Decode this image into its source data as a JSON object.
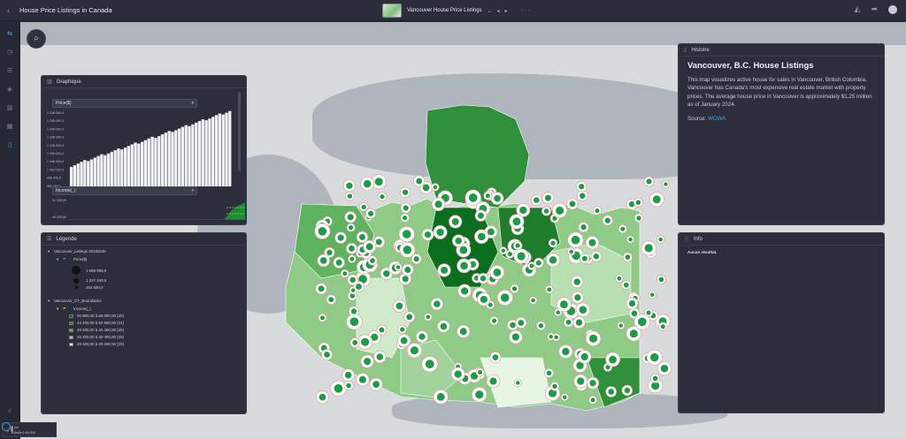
{
  "app": {
    "title": "House Price Listings in Canada",
    "back_icon": "chevron-left-icon",
    "map_title": "Vancouver House Price Listings",
    "more": "· · ·",
    "right_icons": [
      "ruler-icon",
      "share-icon",
      "user-avatar"
    ]
  },
  "left_rail": [
    "layers-icon",
    "clock-icon",
    "list-icon",
    "stack-icon",
    "chart-icon",
    "table-icon",
    "book-icon"
  ],
  "graph_panel": {
    "title": "Graphique",
    "field_1": "Price($)",
    "y_ticks": [
      "1 346 000,0",
      "1 295 000,0",
      "1 246 000,0",
      "1 196 000,0",
      "1 146 000,0",
      "1 096 000,0",
      "1 046 000,0",
      "1 000 000,0",
      "946 000,0",
      "900 000,0"
    ],
    "field_2": "Income(_)",
    "hist_top": "51 205,00",
    "hist_bottom": "45 205,00"
  },
  "legend_panel": {
    "title": "Légende",
    "layer1": {
      "name": "Vancouver_Listings 20240220",
      "field": "Price($)",
      "values": [
        "1 999 999,0",
        "1 227 249,5",
        "454 500,0"
      ]
    },
    "layer2": {
      "name": "Vancouver_CT_Boundaries",
      "field": "Income(_)",
      "classes": [
        {
          "label": "50 900,00 à 68 000,00 (25)",
          "color": "#0b6e1e"
        },
        {
          "label": "44 400,00 à 50 900,00 (24)",
          "color": "#2f8f3a"
        },
        {
          "label": "40 400,00 à 44 400,00 (25)",
          "color": "#5fb35f"
        },
        {
          "label": "35 200,00 à 40 400,00 (25)",
          "color": "#a3d39c"
        },
        {
          "label": "28 200,00 à 35 200,00 (26)",
          "color": "#e8f5e4"
        }
      ]
    }
  },
  "histoire_panel": {
    "title": "Histoire",
    "heading": "Vancouver, B.C. House Listings",
    "body": "This map visualizes active house for sales in Vancouver, British Columbia. Vancouver has Canada's most expensive real estate market with property prices. The average house price in Vancouver is approximately $1.25 million as of January 2024.",
    "source_label": "Source:",
    "source_link": "WOWA"
  },
  "info_panel": {
    "title": "Info",
    "text": "Aucun résultat."
  },
  "scale_bar": {
    "distance": "1 km",
    "scale": "Échelle 1:64 000"
  }
}
